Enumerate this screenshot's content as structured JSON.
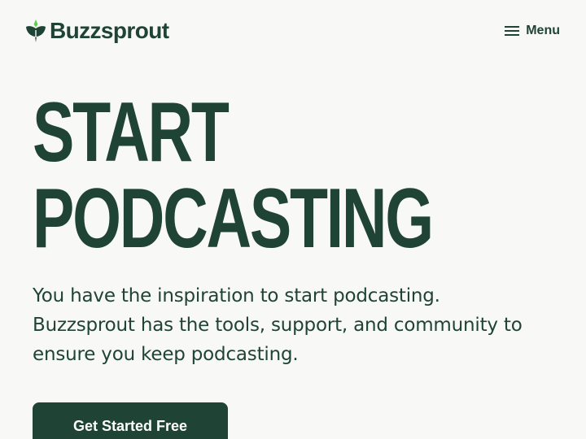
{
  "header": {
    "logo_text": "Buzzsprout",
    "menu_label": "Menu"
  },
  "hero": {
    "title_line1": "START",
    "title_line2": "PODCASTING",
    "description": "You have the inspiration to start podcasting. Buzzsprout has the tools, support, and community to ensure you keep podcasting.",
    "cta_label": "Get Started Free"
  },
  "colors": {
    "brand_green": "#1f4436",
    "accent_green": "#5ccf4f",
    "background": "#f8f8f7",
    "button_text": "#ffffff"
  },
  "icons": {
    "logo_mark": "buzzsprout-sprout-icon",
    "menu": "hamburger-icon"
  }
}
